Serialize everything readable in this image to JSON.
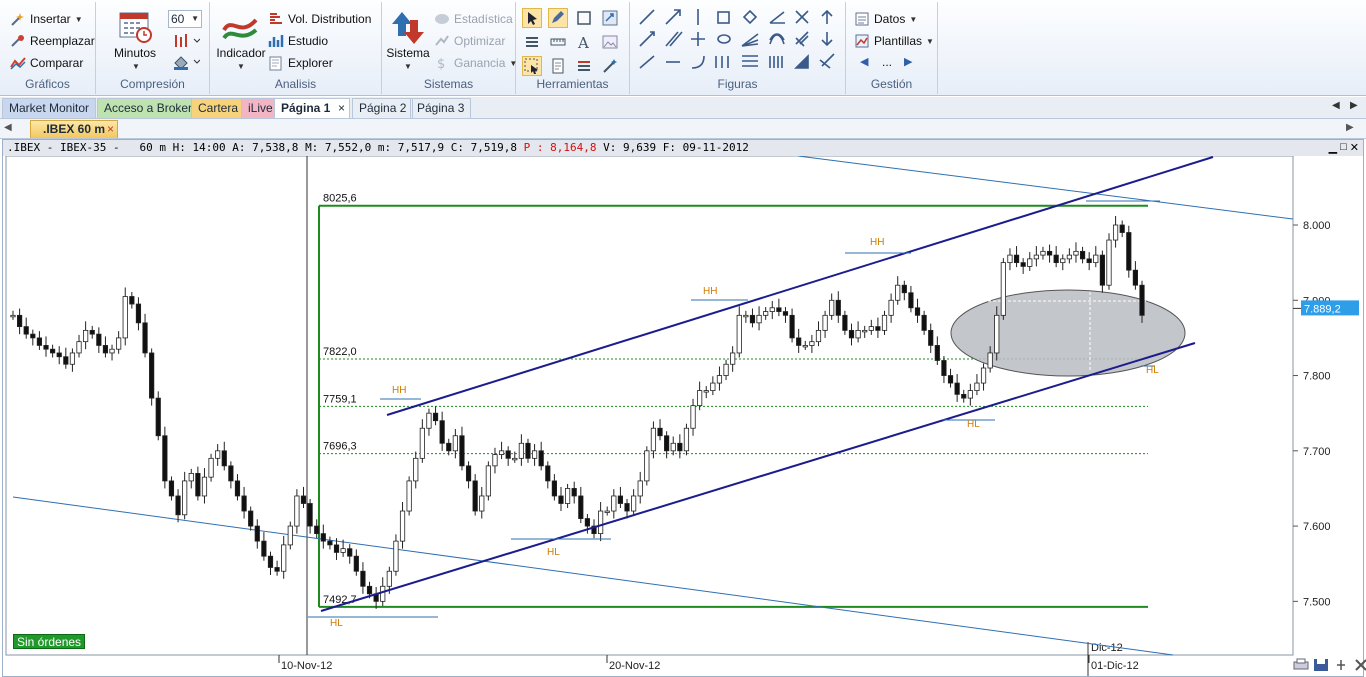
{
  "ribbon": {
    "graficos": {
      "insertar": "Insertar",
      "reemplazar": "Reemplazar",
      "comparar": "Comparar",
      "title": "Gráficos"
    },
    "compresion": {
      "minutos": "Minutos",
      "value": "60",
      "title": "Compresión"
    },
    "analisis": {
      "indicador": "Indicador",
      "vol_distribution": "Vol. Distribution",
      "estudio": "Estudio",
      "explorer": "Explorer",
      "title": "Analisis"
    },
    "sistemas": {
      "sistema": "Sistema",
      "estadistica": "Estadística",
      "optimizar": "Optimizar",
      "ganancia": "Ganancia",
      "title": "Sistemas"
    },
    "herramientas": {
      "title": "Herramientas"
    },
    "figuras": {
      "title": "Figuras"
    },
    "gestion": {
      "datos": "Datos",
      "plantillas": "Plantillas",
      "ellipsis": "...",
      "title": "Gestión"
    }
  },
  "page_tabs": [
    {
      "label": "Market Monitor",
      "color": "#c9d7ee"
    },
    {
      "label": "Acceso a Broker",
      "color": "#bfe3b0"
    },
    {
      "label": "Cartera",
      "color": "#f6d27a"
    },
    {
      "label": "iLive",
      "color": "#f3b5c3"
    },
    {
      "label": "Página 1",
      "color": "#ffffff"
    },
    {
      "label": "Página 2",
      "color": "#e9eef5"
    },
    {
      "label": "Página 3",
      "color": "#e9eef5"
    }
  ],
  "doc_tab": {
    "label": ".IBEX 60 m"
  },
  "infobar": {
    "symbol": ".IBEX - IBEX-35 -",
    "interval": "60 m",
    "high": "H: 14:00",
    "a": "A: 7,538,8",
    "m1": "M: 7,552,0",
    "m2": "m: 7,517,9",
    "c": "C: 7,519,8",
    "p": "P : 8,164,8",
    "v": "V: 9,639",
    "f": "F: 09-11-2012"
  },
  "status": {
    "orders": "Sin órdenes"
  },
  "chart_data": {
    "type": "candlestick",
    "symbol": ".IBEX",
    "interval": "60 m",
    "y_axis_ticks": [
      "8.000",
      "7.900",
      "7.800",
      "7.700",
      "7.600",
      "7.500"
    ],
    "x_axis_ticks": [
      "10-Nov-12",
      "20-Nov-12",
      "01-Dic-12"
    ],
    "x_marker": "Dic-12",
    "last_price": "7.889,2",
    "levels": [
      {
        "label": "8025,6",
        "value": 8025.6
      },
      {
        "label": "7822,0",
        "value": 7822.0
      },
      {
        "label": "7759,1",
        "value": 7759.1
      },
      {
        "label": "7696,3",
        "value": 7696.3
      },
      {
        "label": "7492,7",
        "value": 7492.7
      }
    ],
    "annotations": [
      "HH",
      "HH",
      "HH",
      "HL",
      "HL",
      "HL",
      "HL"
    ],
    "closes": [
      7880,
      7865,
      7855,
      7850,
      7840,
      7835,
      7830,
      7825,
      7815,
      7830,
      7845,
      7860,
      7855,
      7840,
      7830,
      7835,
      7850,
      7905,
      7895,
      7870,
      7830,
      7770,
      7720,
      7660,
      7640,
      7615,
      7660,
      7670,
      7640,
      7665,
      7690,
      7700,
      7680,
      7660,
      7640,
      7620,
      7600,
      7580,
      7560,
      7545,
      7540,
      7575,
      7600,
      7640,
      7630,
      7600,
      7590,
      7580,
      7575,
      7565,
      7570,
      7560,
      7540,
      7520,
      7510,
      7500,
      7520,
      7540,
      7580,
      7620,
      7660,
      7690,
      7730,
      7750,
      7740,
      7710,
      7700,
      7720,
      7680,
      7660,
      7620,
      7640,
      7680,
      7695,
      7700,
      7690,
      7690,
      7710,
      7690,
      7700,
      7680,
      7660,
      7640,
      7630,
      7650,
      7640,
      7610,
      7600,
      7590,
      7620,
      7620,
      7640,
      7630,
      7620,
      7640,
      7660,
      7700,
      7730,
      7720,
      7700,
      7710,
      7700,
      7730,
      7760,
      7780,
      7780,
      7790,
      7800,
      7815,
      7830,
      7880,
      7880,
      7870,
      7880,
      7885,
      7890,
      7885,
      7880,
      7850,
      7840,
      7840,
      7845,
      7860,
      7880,
      7900,
      7880,
      7860,
      7850,
      7860,
      7860,
      7865,
      7860,
      7880,
      7900,
      7920,
      7910,
      7890,
      7880,
      7860,
      7840,
      7820,
      7800,
      7790,
      7775,
      7770,
      7780,
      7790,
      7810,
      7830,
      7880,
      7950,
      7960,
      7950,
      7945,
      7955,
      7960,
      7965,
      7960,
      7950,
      7955,
      7960,
      7965,
      7955,
      7950,
      7960,
      7920,
      7980,
      8000,
      7990,
      7940,
      7920,
      7880
    ]
  },
  "colors": {
    "channel": "#1c1c8c",
    "trendline": "#2f6fb0",
    "range_box": "#1f8a1f",
    "level_lines": "#1f8a1f",
    "annotation": "#d07a00",
    "last_price_bg": "#2e9ee8",
    "ellipse": "#b8bcc2",
    "status_bg": "#1f9a2a"
  }
}
